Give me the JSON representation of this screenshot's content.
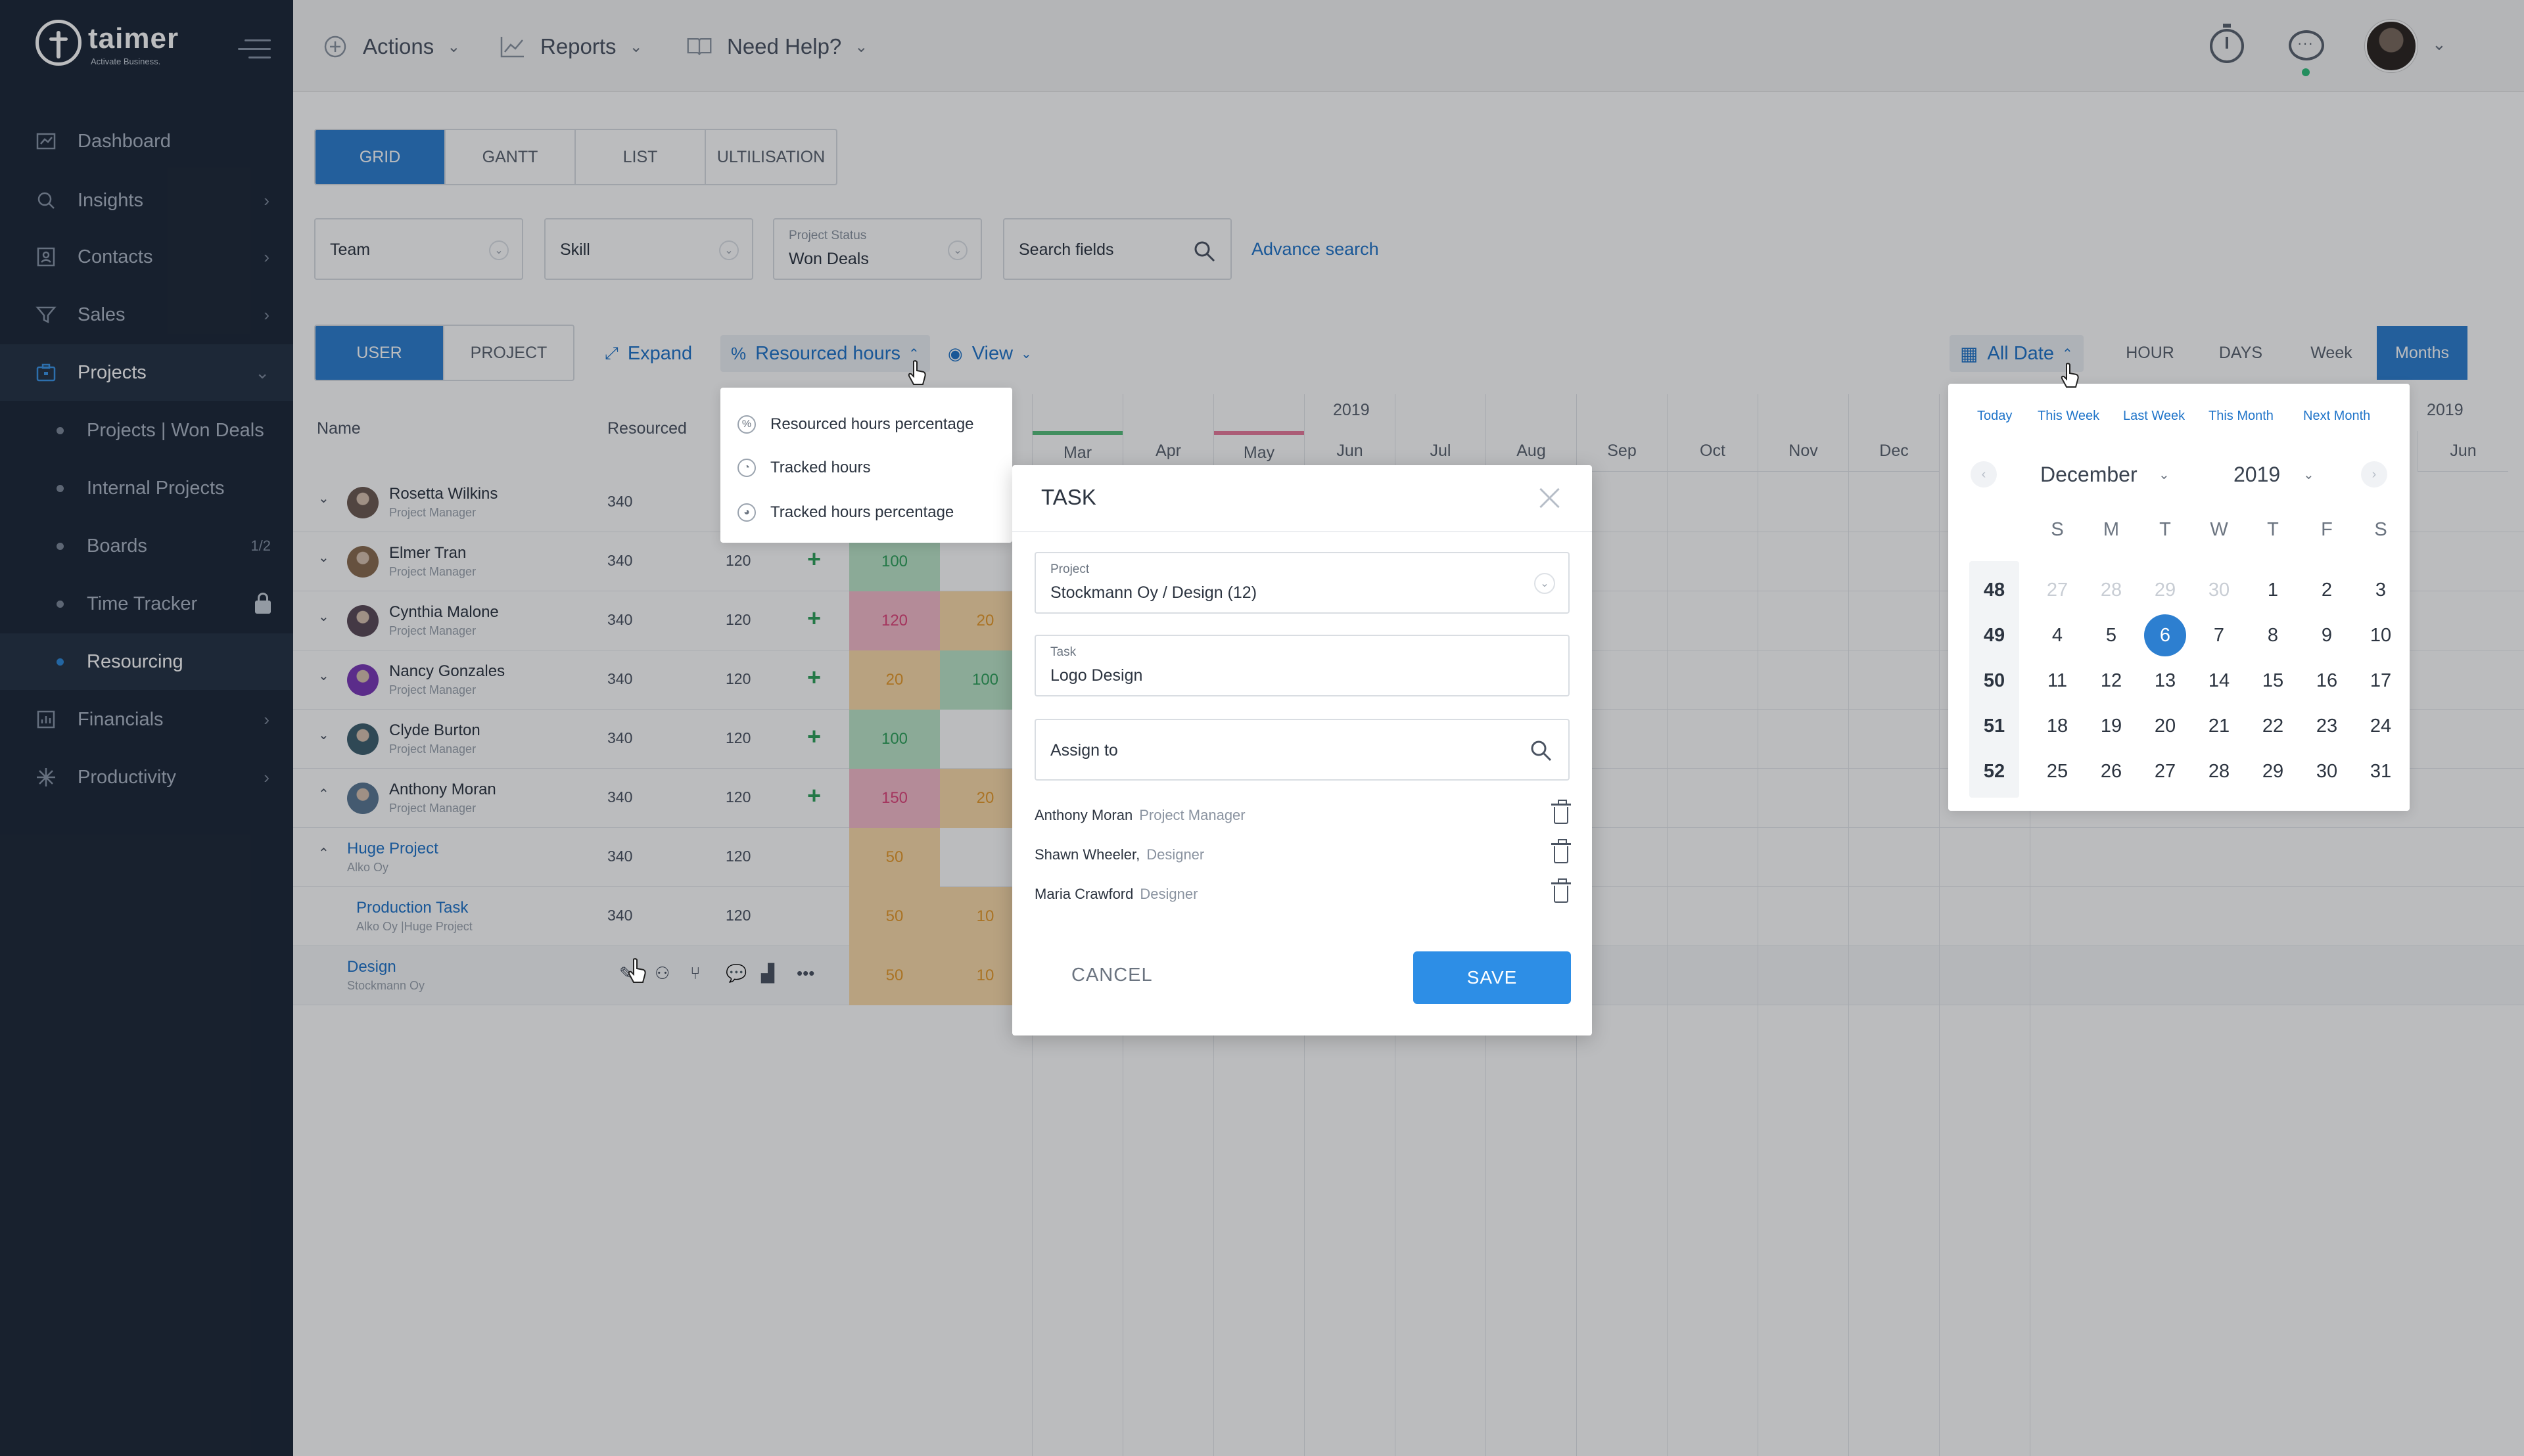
{
  "brand": {
    "name": "taimer",
    "tagline": "Activate Business."
  },
  "sidebar": {
    "items": [
      {
        "label": "Dashboard",
        "icon": "dashboard-icon",
        "chevron": ""
      },
      {
        "label": "Insights",
        "icon": "insights-icon",
        "chevron": "›"
      },
      {
        "label": "Contacts",
        "icon": "contacts-icon",
        "chevron": "›"
      },
      {
        "label": "Sales",
        "icon": "funnel-icon",
        "chevron": "›"
      },
      {
        "label": "Projects",
        "icon": "briefcase-icon",
        "chevron": "⌄"
      }
    ],
    "project_subitems": [
      {
        "label": "Projects | Won Deals",
        "extra": ""
      },
      {
        "label": "Internal Projects",
        "extra": ""
      },
      {
        "label": "Boards",
        "extra": "1/2"
      },
      {
        "label": "Time Tracker",
        "extra": "lock-icon"
      },
      {
        "label": "Resourcing",
        "extra": ""
      }
    ],
    "bottom_items": [
      {
        "label": "Financials",
        "icon": "financials-icon",
        "chevron": "›"
      },
      {
        "label": "Productivity",
        "icon": "productivity-icon",
        "chevron": "›"
      }
    ]
  },
  "topbar": {
    "actions": "Actions",
    "reports": "Reports",
    "help": "Need Help?"
  },
  "view_tabs": [
    "GRID",
    "GANTT",
    "LIST",
    "ULTILISATION"
  ],
  "filters": {
    "team": "Team",
    "skill": "Skill",
    "project_status_label": "Project Status",
    "project_status_value": "Won Deals",
    "search_placeholder": "Search fields",
    "advance_search": "Advance search"
  },
  "toolbar": {
    "mode_tabs": [
      "USER",
      "PROJECT"
    ],
    "expand": "Expand",
    "resourced_hours": "Resourced hours",
    "view": "View",
    "all_date": "All Date",
    "units": [
      "HOUR",
      "DAYS",
      "Week",
      "Months"
    ]
  },
  "resourced_menu": [
    "Resourced hours percentage",
    "Tracked hours",
    "Tracked hours percentage"
  ],
  "grid": {
    "col_name": "Name",
    "col_resourced": "Resourced",
    "year_label": "2019",
    "year_label_right": "2019",
    "months": [
      "Mar",
      "Apr",
      "May",
      "Jun",
      "Jul",
      "Aug",
      "Sep",
      "Oct",
      "Nov",
      "Dec"
    ],
    "right_month": "Jun",
    "rows": [
      {
        "name": "Rosetta Wilkins",
        "role": "Project Manager",
        "resourced": "340",
        "tracked": "",
        "chev": "⌄",
        "c1": "",
        "c2": "",
        "avatar": "#6d5a52"
      },
      {
        "name": "Elmer Tran",
        "role": "Project Manager",
        "resourced": "340",
        "tracked": "120",
        "chev": "⌄",
        "c1": "100",
        "c2": "",
        "avatar": "#8a6b4f"
      },
      {
        "name": "Cynthia Malone",
        "role": "Project Manager",
        "resourced": "340",
        "tracked": "120",
        "chev": "⌄",
        "c1": "120",
        "c2": "20",
        "avatar": "#5b4a58"
      },
      {
        "name": "Nancy Gonzales",
        "role": "Project Manager",
        "resourced": "340",
        "tracked": "120",
        "chev": "⌄",
        "c1": "20",
        "c2": "100",
        "avatar": "#7a38b8"
      },
      {
        "name": "Clyde Burton",
        "role": "Project Manager",
        "resourced": "340",
        "tracked": "120",
        "chev": "⌄",
        "c1": "100",
        "c2": "",
        "avatar": "#3e5f6e"
      },
      {
        "name": "Anthony Moran",
        "role": "Project Manager",
        "resourced": "340",
        "tracked": "120",
        "chev": "⌃",
        "c1": "150",
        "c2": "20",
        "avatar": "#5a7894"
      }
    ],
    "projects": [
      {
        "name": "Huge Project",
        "sub": "Alko Oy",
        "resourced": "340",
        "tracked": "120",
        "c1": "50",
        "c2": ""
      },
      {
        "name": "Production Task",
        "sub": "Alko Oy |Huge Project",
        "resourced": "340",
        "tracked": "120",
        "c1": "50",
        "c2": "10"
      },
      {
        "name": "Design",
        "sub": "Stockmann Oy",
        "resourced": "",
        "tracked": "",
        "c1": "50",
        "c2": "10"
      }
    ]
  },
  "datepicker": {
    "quick": [
      "Today",
      "This Week",
      "Last Week",
      "This Month",
      "Next Month"
    ],
    "month": "December",
    "year": "2019",
    "dow": [
      "S",
      "M",
      "T",
      "W",
      "T",
      "F",
      "S"
    ],
    "weeks": [
      "48",
      "49",
      "50",
      "51",
      "52"
    ],
    "days": [
      [
        "27",
        "28",
        "29",
        "30",
        "1",
        "2",
        "3"
      ],
      [
        "4",
        "5",
        "6",
        "7",
        "8",
        "9",
        "10"
      ],
      [
        "11",
        "12",
        "13",
        "14",
        "15",
        "16",
        "17"
      ],
      [
        "18",
        "19",
        "20",
        "21",
        "22",
        "23",
        "24"
      ],
      [
        "25",
        "26",
        "27",
        "28",
        "29",
        "30",
        "31"
      ]
    ],
    "selected": "6"
  },
  "modal": {
    "title": "TASK",
    "project_label": "Project",
    "project_value": "Stockmann Oy /  Design (12)",
    "task_label": "Task",
    "task_value": "Logo Design",
    "assign_placeholder": "Assign to",
    "assignees": [
      {
        "name": "Anthony Moran",
        "role": "Project Manager"
      },
      {
        "name": "Shawn Wheeler,",
        "role": "Designer"
      },
      {
        "name": "Maria Crawford",
        "role": "Designer"
      }
    ],
    "cancel": "CANCEL",
    "save": "SAVE"
  },
  "colors": {
    "primary": "#2d7fd0",
    "sidebar_bg": "#1d2838",
    "cell_green": "#bde6c9",
    "cell_red": "#f6bccb",
    "cell_orange": "#fbdcaa",
    "text_green": "#2ea15a",
    "text_red": "#e0457b",
    "text_orange": "#e89a2a"
  }
}
